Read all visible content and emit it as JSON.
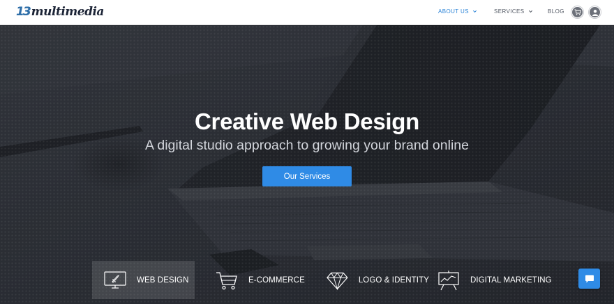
{
  "brand": {
    "mark": "13",
    "name": "multimedia",
    "color": "#2f6fa9"
  },
  "nav": {
    "items": [
      {
        "label": "ABOUT US",
        "active": true,
        "dropdown": true
      },
      {
        "label": "SERVICES",
        "active": false,
        "dropdown": true
      },
      {
        "label": "BLOG",
        "active": false,
        "dropdown": false
      }
    ],
    "icons": [
      "cart-icon",
      "user-icon"
    ],
    "active_color": "#2f86d8"
  },
  "hero": {
    "title": "Creative Web Design",
    "subtitle": "A digital studio approach to growing your brand online",
    "cta_label": "Our Services",
    "cta_color": "#2f8be6"
  },
  "services": [
    {
      "label": "WEB DESIGN",
      "icon": "monitor-rocket-icon",
      "active": true
    },
    {
      "label": "E-COMMERCE",
      "icon": "shopping-cart-icon",
      "active": false
    },
    {
      "label": "LOGO & IDENTITY",
      "icon": "diamond-icon",
      "active": false
    },
    {
      "label": "DIGITAL MARKETING",
      "icon": "presentation-chart-icon",
      "active": false
    }
  ],
  "chat": {
    "icon": "chat-bubble-icon"
  }
}
